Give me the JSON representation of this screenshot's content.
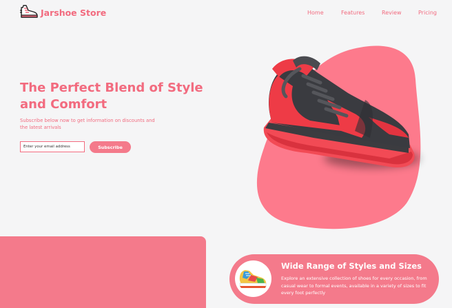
{
  "brand": {
    "name": "Jarshoe Store",
    "logo_icon": "sneaker-logo-icon"
  },
  "nav": {
    "links": [
      "Home",
      "Features",
      "Review",
      "Pricing"
    ]
  },
  "hero": {
    "title": "The Perfect Blend of Style and Comfort",
    "subtitle": "Subscribe below now to get information on discounts and the latest arrivals",
    "email_placeholder": "Enter your email address",
    "subscribe_label": "Subscribe",
    "image_icon": "red-black-sneaker-image"
  },
  "feature": {
    "title": "Wide Range of Styles and Sizes",
    "description": "Explore an extensive collection of shoes for every occasion, from casual wear to formal events, available in a variety of sizes to fit every foot perfectly",
    "image_icon": "colorful-sneaker-image"
  },
  "colors": {
    "accent": "#f26b7f",
    "panel": "#f47a8b",
    "background": "#f5f5f6"
  }
}
